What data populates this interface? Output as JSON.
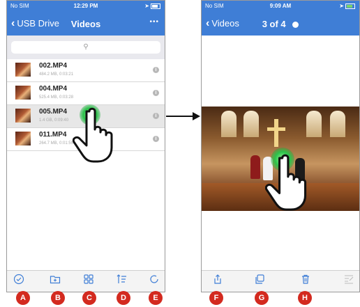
{
  "left_screen": {
    "status": {
      "carrier": "No SIM",
      "time": "12:29 PM"
    },
    "nav": {
      "back_label": "USB Drive",
      "title": "Videos",
      "more": "•••"
    },
    "search": {
      "icon": "search-icon"
    },
    "files": [
      {
        "name": "002.MP4",
        "meta": "484.2 MB, 0:03:21"
      },
      {
        "name": "004.MP4",
        "meta": "525.4 MB, 0:03:28"
      },
      {
        "name": "005.MP4",
        "meta": "1.4 GB, 0:09:40"
      },
      {
        "name": "011.MP4",
        "meta": "264.7 MB, 0:01:55"
      }
    ],
    "toolbar": [
      "select-icon",
      "new-folder-icon",
      "grid-icon",
      "sort-icon",
      "refresh-icon"
    ]
  },
  "right_screen": {
    "status": {
      "carrier": "No SIM",
      "time": "9:09 AM"
    },
    "nav": {
      "back_label": "Videos",
      "title": "3 of 4"
    },
    "toolbar": [
      "share-icon",
      "copy-icon",
      "trash-icon",
      "edit-icon"
    ]
  },
  "badges": [
    "A",
    "B",
    "C",
    "D",
    "E",
    "F",
    "G",
    "H"
  ],
  "colors": {
    "accent": "#3f7ed6",
    "badge": "#d32a1f",
    "touch": "#2bc24a"
  }
}
